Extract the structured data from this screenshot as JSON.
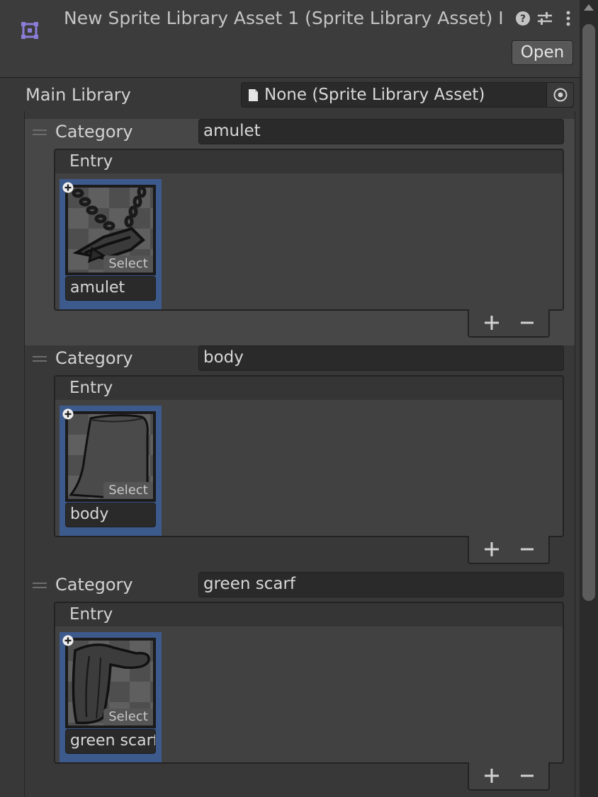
{
  "header": {
    "title": "New Sprite Library Asset 1 (Sprite Library Asset) I",
    "open_label": "Open",
    "icons": [
      "sprite-library-asset-icon",
      "help-icon",
      "presets-icon",
      "kebab-menu-icon"
    ]
  },
  "main_library": {
    "label": "Main Library",
    "value": "None (Sprite Library Asset)"
  },
  "categories": [
    {
      "label": "Category",
      "name": "amulet",
      "entry_header": "Entry",
      "entries": [
        {
          "name": "amulet",
          "select_label": "Select",
          "sprite": "amulet-sprite"
        }
      ],
      "selected": true
    },
    {
      "label": "Category",
      "name": "body",
      "entry_header": "Entry",
      "entries": [
        {
          "name": "body",
          "select_label": "Select",
          "sprite": "body-sprite"
        }
      ],
      "selected": false
    },
    {
      "label": "Category",
      "name": "green scarf",
      "entry_header": "Entry",
      "entries": [
        {
          "name": "green scarf",
          "select_label": "Select",
          "sprite": "green-scarf-sprite"
        }
      ],
      "selected": false
    }
  ],
  "colors": {
    "background": "#383838",
    "selected_tile": "#3d5a8c",
    "field": "#2a2a2a"
  }
}
